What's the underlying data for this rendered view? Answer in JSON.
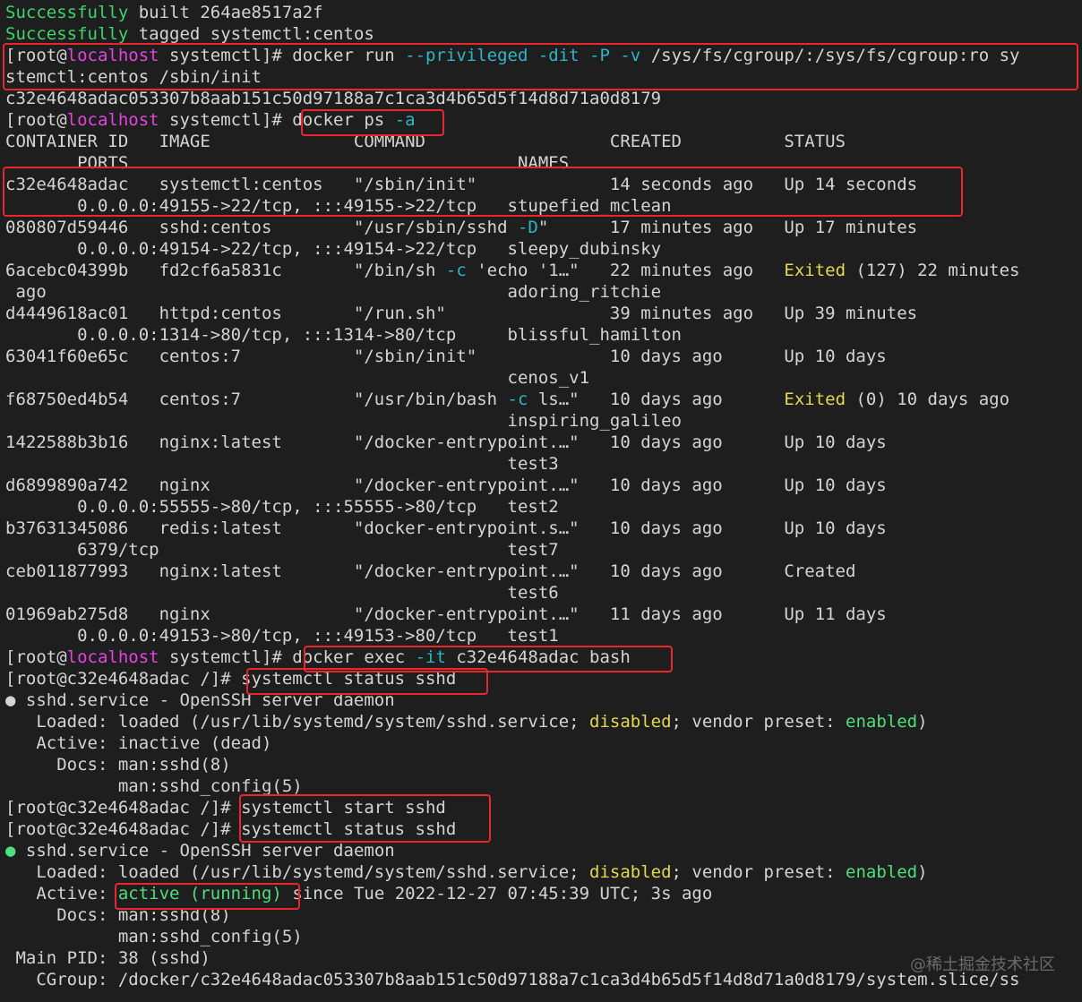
{
  "lines": [
    [
      {
        "t": "Successfully",
        "c": "green"
      },
      {
        "t": " built 264ae8517a2f"
      }
    ],
    [
      {
        "t": "Successfully",
        "c": "green"
      },
      {
        "t": " tagged systemctl:centos"
      }
    ],
    [
      {
        "t": "[root@"
      },
      {
        "t": "localhost",
        "c": "pink"
      },
      {
        "t": " systemctl]# docker run "
      },
      {
        "t": "--privileged -dit -P -v",
        "c": "cyan"
      },
      {
        "t": " /sys/fs/cgroup/:/sys/fs/cgroup:ro sy"
      }
    ],
    [
      {
        "t": "stemctl:centos /sbin/init"
      }
    ],
    [
      {
        "t": "c32e4648adac053307b8aab151c50d97188a7c1ca3d4b65d5f14d8d71a0d8179"
      }
    ],
    [
      {
        "t": "[root@"
      },
      {
        "t": "localhost",
        "c": "pink"
      },
      {
        "t": " systemctl]# docker ps "
      },
      {
        "t": "-a",
        "c": "cyan"
      }
    ],
    [
      {
        "t": "CONTAINER ID   IMAGE              COMMAND                  CREATED          STATUS"
      }
    ],
    [
      {
        "t": "       PORTS                                      NAMES"
      }
    ],
    [
      {
        "t": "c32e4648adac   systemctl:centos   \"/sbin/init\"             14 seconds ago   Up 14 seconds"
      }
    ],
    [
      {
        "t": "       0.0.0.0:49155->22/tcp, :::49155->22/tcp   stupefied_mclean"
      }
    ],
    [
      {
        "t": "080807d59446   sshd:centos        \"/usr/sbin/sshd "
      },
      {
        "t": "-D",
        "c": "cyan"
      },
      {
        "t": "\"      17 minutes ago   Up 17 minutes"
      }
    ],
    [
      {
        "t": "       0.0.0.0:49154->22/tcp, :::49154->22/tcp   sleepy_dubinsky"
      }
    ],
    [
      {
        "t": "6acebc04399b   fd2cf6a5831c       \"/bin/sh "
      },
      {
        "t": "-c",
        "c": "cyan"
      },
      {
        "t": " 'echo '1…\"   22 minutes ago   "
      },
      {
        "t": "Exited",
        "c": "yellow"
      },
      {
        "t": " (127) 22 minutes"
      }
    ],
    [
      {
        "t": " ago                                             adoring_ritchie"
      }
    ],
    [
      {
        "t": "d4449618ac01   httpd:centos       \"/run.sh\"                39 minutes ago   Up 39 minutes"
      }
    ],
    [
      {
        "t": "       0.0.0.0:1314->80/tcp, :::1314->80/tcp     blissful_hamilton"
      }
    ],
    [
      {
        "t": "63041f60e65c   centos:7           \"/sbin/init\"             10 days ago      Up 10 days"
      }
    ],
    [
      {
        "t": "                                                 cenos_v1"
      }
    ],
    [
      {
        "t": "f68750ed4b54   centos:7           \"/usr/bin/bash "
      },
      {
        "t": "-c",
        "c": "cyan"
      },
      {
        "t": " ls…\"   10 days ago      "
      },
      {
        "t": "Exited",
        "c": "yellow"
      },
      {
        "t": " (0) 10 days ago"
      }
    ],
    [
      {
        "t": "                                                 inspiring_galileo"
      }
    ],
    [
      {
        "t": "1422588b3b16   nginx:latest       \"/docker-entrypoint.…\"   10 days ago      Up 10 days"
      }
    ],
    [
      {
        "t": "                                                 test3"
      }
    ],
    [
      {
        "t": "d6899890a742   nginx              \"/docker-entrypoint.…\"   10 days ago      Up 10 days"
      }
    ],
    [
      {
        "t": "       0.0.0.0:55555->80/tcp, :::55555->80/tcp   test2"
      }
    ],
    [
      {
        "t": "b37631345086   redis:latest       \"docker-entrypoint.s…\"   10 days ago      Up 10 days"
      }
    ],
    [
      {
        "t": "       6379/tcp                                  test7"
      }
    ],
    [
      {
        "t": "ceb011877993   nginx:latest       \"/docker-entrypoint.…\"   10 days ago      Created"
      }
    ],
    [
      {
        "t": "                                                 test6"
      }
    ],
    [
      {
        "t": "01969ab275d8   nginx              \"/docker-entrypoint.…\"   11 days ago      Up 11 days"
      }
    ],
    [
      {
        "t": "       0.0.0.0:49153->80/tcp, :::49153->80/tcp   test1"
      }
    ],
    [
      {
        "t": "[root@"
      },
      {
        "t": "localhost",
        "c": "pink"
      },
      {
        "t": " systemctl]# docker exec "
      },
      {
        "t": "-it",
        "c": "cyan"
      },
      {
        "t": " c32e4648adac bash"
      }
    ],
    [
      {
        "t": "[root@c32e4648adac /]# systemctl status sshd"
      }
    ],
    [
      {
        "t": "● sshd.service - OpenSSH server daemon"
      }
    ],
    [
      {
        "t": "   Loaded: loaded (/usr/lib/systemd/system/sshd.service; "
      },
      {
        "t": "disabled",
        "c": "yellow"
      },
      {
        "t": "; vendor preset: "
      },
      {
        "t": "enabled",
        "c": "bright-green"
      },
      {
        "t": ")"
      }
    ],
    [
      {
        "t": "   Active: inactive (dead)"
      }
    ],
    [
      {
        "t": "     Docs: man:sshd(8)"
      }
    ],
    [
      {
        "t": "           man:sshd_config(5)"
      }
    ],
    [
      {
        "t": "[root@c32e4648adac /]# systemctl start sshd"
      }
    ],
    [
      {
        "t": "[root@c32e4648adac /]# systemctl status sshd"
      }
    ],
    [
      {
        "t": "●",
        "c": "bright-green"
      },
      {
        "t": " sshd.service - OpenSSH server daemon"
      }
    ],
    [
      {
        "t": "   Loaded: loaded (/usr/lib/systemd/system/sshd.service; "
      },
      {
        "t": "disabled",
        "c": "yellow"
      },
      {
        "t": "; vendor preset: "
      },
      {
        "t": "enabled",
        "c": "bright-green"
      },
      {
        "t": ")"
      }
    ],
    [
      {
        "t": "   Active: "
      },
      {
        "t": "active (running)",
        "c": "bright-green"
      },
      {
        "t": " since Tue 2022-12-27 07:45:39 UTC; 3s ago"
      }
    ],
    [
      {
        "t": "     Docs: man:sshd(8)"
      }
    ],
    [
      {
        "t": "           man:sshd_config(5)"
      }
    ],
    [
      {
        "t": " Main PID: 38 (sshd)"
      }
    ],
    [
      {
        "t": "   CGroup: /docker/c32e4648adac053307b8aab151c50d97188a7c1ca3d4b65d5f14d8d71a0d8179/system.slice/ss"
      }
    ]
  ],
  "watermark": "@稀土掘金技术社区",
  "colors": {
    "background": "#1e1e1e",
    "text": "#d4d4d4",
    "success": "#3fd46b",
    "hostname": "#e542e0",
    "flag": "#2bb6c9",
    "warning": "#e3d84e",
    "enabled": "#4ce07a",
    "highlight_box": "#e8262b"
  }
}
